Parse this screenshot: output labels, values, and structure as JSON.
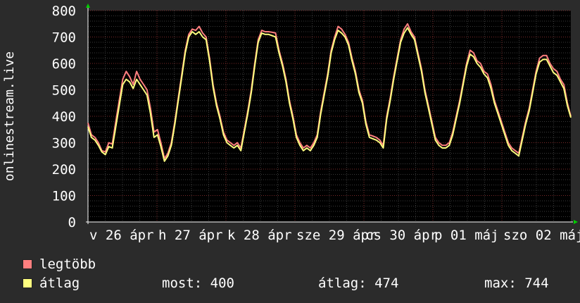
{
  "chart_data": {
    "type": "line",
    "ylabel": "onlinestream.live",
    "ylim": [
      0,
      800
    ],
    "yticks": [
      0,
      100,
      200,
      300,
      400,
      500,
      600,
      700,
      800
    ],
    "x_tick_labels": [
      "v 26 ápr",
      "h 27 ápr",
      "k 28 ápr",
      "sze 29 ápr",
      "cs 30 ápr",
      "p 01 máj",
      "szo 02 máj"
    ],
    "grid": true,
    "series": [
      {
        "name": "legtöbb",
        "color": "#ff7f7f",
        "values": [
          375,
          330,
          320,
          300,
          270,
          265,
          300,
          295,
          380,
          460,
          540,
          570,
          550,
          520,
          570,
          540,
          520,
          500,
          430,
          340,
          350,
          300,
          240,
          260,
          300,
          380,
          470,
          560,
          650,
          710,
          730,
          725,
          740,
          715,
          700,
          620,
          520,
          450,
          400,
          340,
          310,
          300,
          290,
          300,
          280,
          350,
          420,
          500,
          600,
          690,
          725,
          720,
          720,
          718,
          715,
          650,
          600,
          540,
          460,
          400,
          330,
          300,
          280,
          290,
          280,
          300,
          330,
          420,
          490,
          560,
          650,
          700,
          740,
          730,
          710,
          680,
          620,
          570,
          500,
          460,
          380,
          330,
          325,
          320,
          310,
          290,
          400,
          470,
          550,
          620,
          690,
          730,
          750,
          720,
          700,
          640,
          580,
          500,
          440,
          380,
          320,
          300,
          290,
          290,
          300,
          340,
          400,
          460,
          530,
          600,
          650,
          640,
          610,
          600,
          570,
          560,
          520,
          460,
          420,
          380,
          340,
          300,
          280,
          270,
          260,
          320,
          380,
          430,
          500,
          570,
          620,
          630,
          630,
          600,
          580,
          570,
          540,
          520,
          450,
          400
        ]
      },
      {
        "name": "átlag",
        "color": "#ffff7f",
        "values": [
          360,
          320,
          310,
          290,
          265,
          255,
          285,
          280,
          360,
          440,
          520,
          540,
          530,
          505,
          540,
          520,
          500,
          480,
          410,
          320,
          330,
          285,
          230,
          250,
          290,
          370,
          460,
          550,
          640,
          700,
          720,
          710,
          720,
          700,
          690,
          610,
          510,
          440,
          390,
          330,
          300,
          290,
          280,
          290,
          270,
          340,
          410,
          490,
          590,
          680,
          715,
          710,
          710,
          705,
          700,
          640,
          590,
          530,
          450,
          390,
          320,
          290,
          270,
          280,
          270,
          290,
          320,
          410,
          480,
          550,
          640,
          690,
          725,
          715,
          700,
          670,
          610,
          560,
          490,
          450,
          370,
          320,
          315,
          310,
          300,
          280,
          390,
          460,
          540,
          610,
          680,
          715,
          735,
          710,
          690,
          630,
          570,
          490,
          430,
          370,
          310,
          290,
          280,
          280,
          290,
          330,
          390,
          450,
          520,
          590,
          635,
          625,
          600,
          585,
          560,
          545,
          505,
          450,
          410,
          370,
          330,
          290,
          270,
          260,
          250,
          310,
          370,
          420,
          490,
          560,
          605,
          615,
          615,
          590,
          565,
          555,
          530,
          505,
          440,
          395
        ]
      }
    ]
  },
  "legend": {
    "items": [
      {
        "label": "legtöbb",
        "color": "#ff7f7f"
      },
      {
        "label": "átlag",
        "color": "#ffff7f"
      }
    ]
  },
  "stats": {
    "current": "most: 400",
    "average": "átlag: 474",
    "max": "max: 744"
  }
}
